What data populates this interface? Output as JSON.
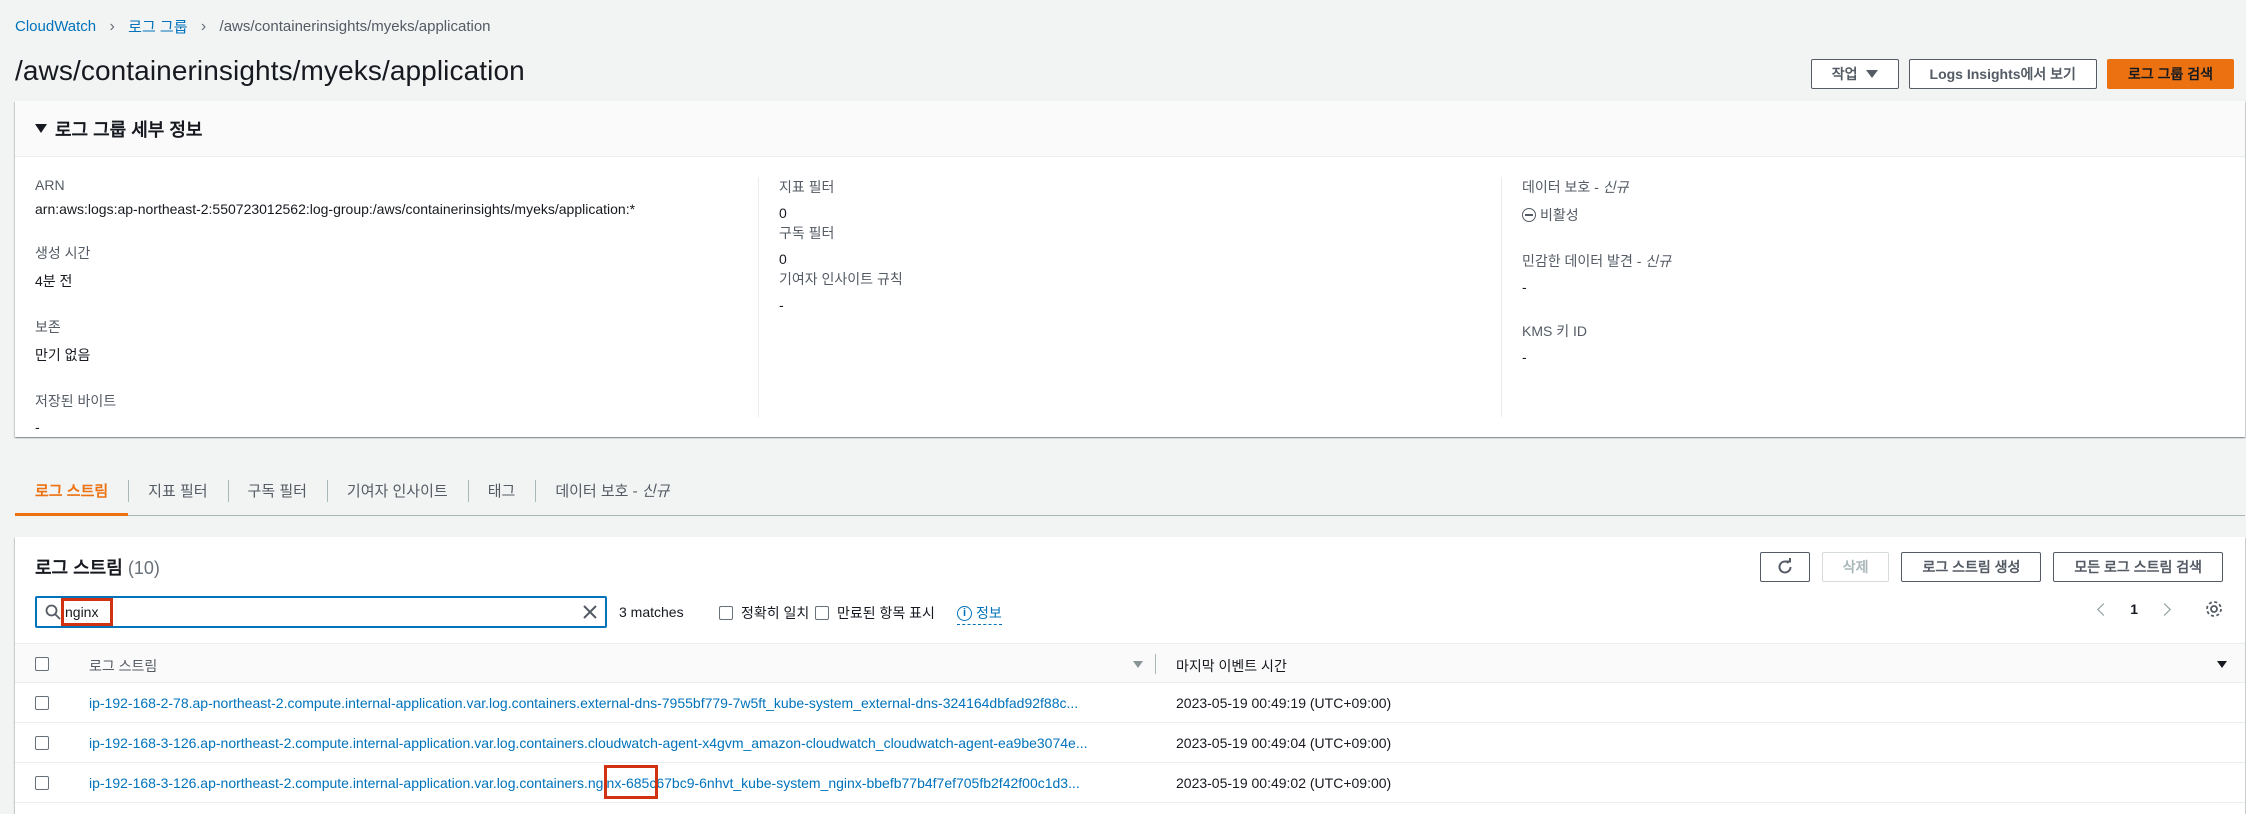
{
  "breadcrumb": {
    "items": [
      "CloudWatch",
      "로그 그룹"
    ],
    "current": "/aws/containerinsights/myeks/application"
  },
  "page": {
    "title": "/aws/containerinsights/myeks/application",
    "actions_label": "작업",
    "logs_insights_label": "Logs Insights에서 보기",
    "search_group_label": "로그 그룹 검색"
  },
  "details": {
    "heading": "로그 그룹 세부 정보",
    "arn_label": "ARN",
    "arn_value": "arn:aws:logs:ap-northeast-2:550723012562:log-group:/aws/containerinsights/myeks/application:*",
    "created_label": "생성 시간",
    "created_value": "4분 전",
    "retention_label": "보존",
    "retention_value": "만기 없음",
    "stored_label": "저장된 바이트",
    "stored_value": "-",
    "metric_filter_label": "지표 필터",
    "metric_filter_value": "0",
    "subscription_label": "구독 필터",
    "subscription_value": "0",
    "contributor_label": "기여자 인사이트 규칙",
    "contributor_value": "-",
    "data_protection_label": "데이터 보호 - ",
    "data_protection_new": "신규",
    "data_protection_value": "비활성",
    "sensitive_label": "민감한 데이터 발견 - ",
    "sensitive_new": "신규",
    "sensitive_value": "-",
    "kms_label": "KMS 키 ID",
    "kms_value": "-"
  },
  "tabs": [
    {
      "label": "로그 스트림",
      "active": true
    },
    {
      "label": "지표 필터"
    },
    {
      "label": "구독 필터"
    },
    {
      "label": "기여자 인사이트"
    },
    {
      "label": "태그"
    },
    {
      "label": "데이터 보호 - ",
      "suffix": "신규"
    }
  ],
  "streams": {
    "title": "로그 스트림",
    "count": "(10)",
    "delete_label": "삭제",
    "create_label": "로그 스트림 생성",
    "search_all_label": "모든 로그 스트림 검색",
    "search_value": "nginx",
    "matches": "3 matches",
    "exact_match_label": "정확히 일치",
    "show_expired_label": "만료된 항목 표시",
    "info_label": "정보",
    "page": "1",
    "col_name": "로그 스트림",
    "col_time": "마지막 이벤트 시간",
    "rows": [
      {
        "name": "ip-192-168-2-78.ap-northeast-2.compute.internal-application.var.log.containers.external-dns-7955bf779-7w5ft_kube-system_external-dns-324164dbfad92f88c...",
        "time": "2023-05-19 00:49:19 (UTC+09:00)"
      },
      {
        "name": "ip-192-168-3-126.ap-northeast-2.compute.internal-application.var.log.containers.cloudwatch-agent-x4gvm_amazon-cloudwatch_cloudwatch-agent-ea9be3074e...",
        "time": "2023-05-19 00:49:04 (UTC+09:00)"
      },
      {
        "name": "ip-192-168-3-126.ap-northeast-2.compute.internal-application.var.log.containers.nginx-685c67bc9-6nhvt_kube-system_nginx-bbefb77b4f7ef705fb2f42f00c1d3...",
        "time": "2023-05-19 00:49:02 (UTC+09:00)"
      }
    ]
  },
  "colors": {
    "accent": "#ec7211",
    "link": "#0073bb",
    "annotation": "#d13212"
  }
}
